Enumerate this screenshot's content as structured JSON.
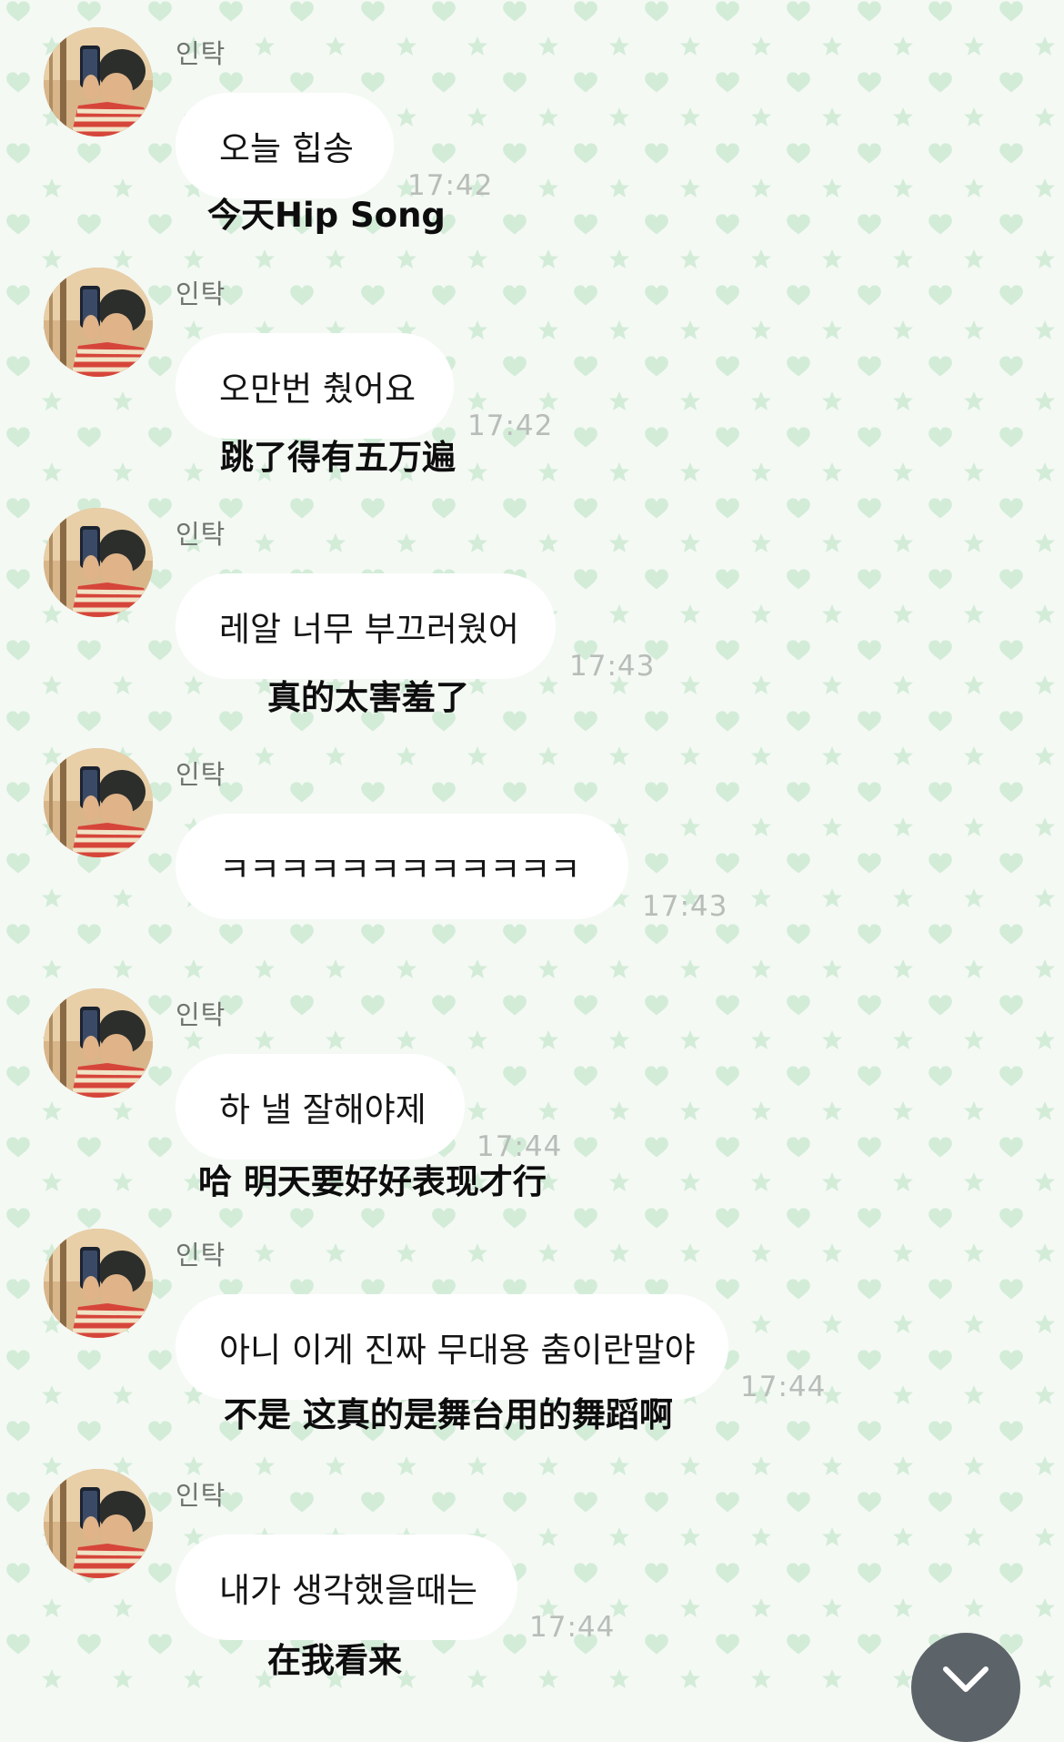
{
  "chat": {
    "messages": [
      {
        "sender": "인탁",
        "text": "오늘 힙송",
        "time": "17:42",
        "translation": "今天Hip Song"
      },
      {
        "sender": "인탁",
        "text": "오만번 췄어요",
        "time": "17:42",
        "translation": "跳了得有五万遍"
      },
      {
        "sender": "인탁",
        "text": "레알 너무 부끄러웠어",
        "time": "17:43",
        "translation": "真的太害羞了"
      },
      {
        "sender": "인탁",
        "text": "ㅋㅋㅋㅋㅋㅋㅋㅋㅋㅋㅋㅋ",
        "time": "17:43",
        "translation": ""
      },
      {
        "sender": "인탁",
        "text": "하 낼 잘해야제",
        "time": "17:44",
        "translation": "哈 明天要好好表现才行"
      },
      {
        "sender": "인탁",
        "text": "아니 이게 진짜 무대용 춤이란말야",
        "time": "17:44",
        "translation": "不是 这真的是舞台用的舞蹈啊"
      },
      {
        "sender": "인탁",
        "text": "내가 생각했을때는",
        "time": "17:44",
        "translation": "在我看来"
      }
    ]
  },
  "theme": {
    "background": "#f4f9f4",
    "pattern_color": "#d3ecd8",
    "bubble_color": "#ffffff",
    "time_color": "#b9bdb9"
  },
  "icons": {
    "scroll_down": "chevron-down-icon"
  }
}
